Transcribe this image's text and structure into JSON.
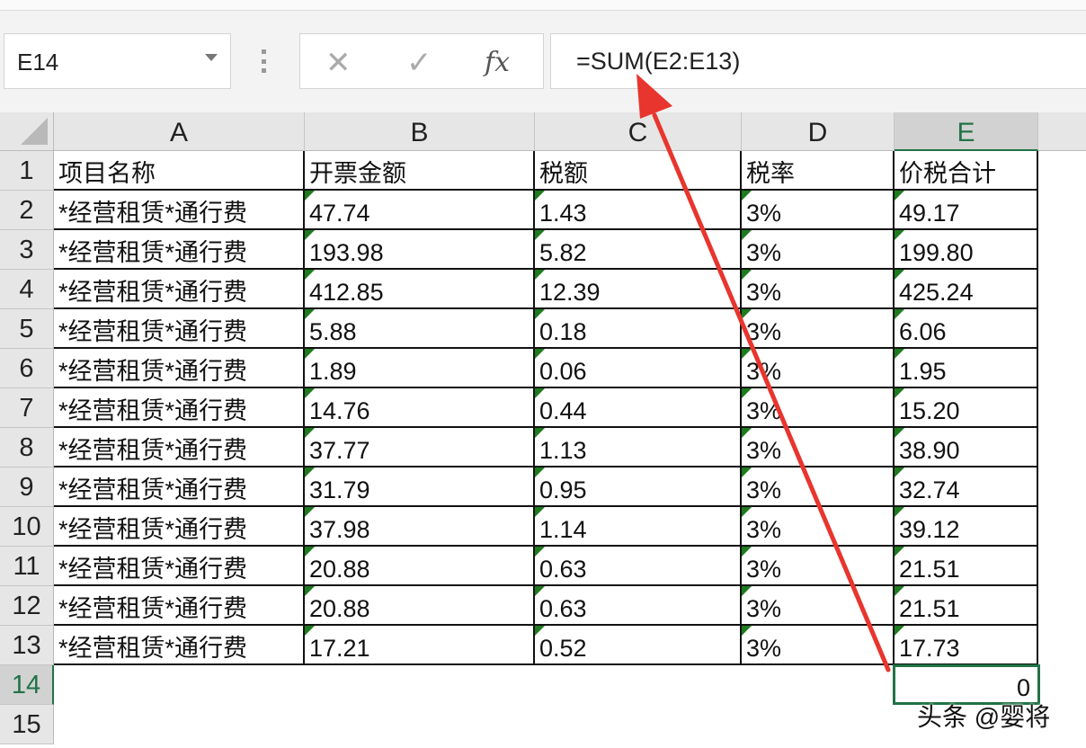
{
  "name_box": {
    "value": "E14"
  },
  "formula_bar": {
    "cancel_icon": "✕",
    "enter_icon": "✓",
    "fx_label": "fx",
    "formula": "=SUM(E2:E13)"
  },
  "columns": [
    "A",
    "B",
    "C",
    "D",
    "E"
  ],
  "selected_column": "E",
  "selected_row": 14,
  "row_numbers": [
    1,
    2,
    3,
    4,
    5,
    6,
    7,
    8,
    9,
    10,
    11,
    12,
    13,
    14,
    15
  ],
  "header_row": [
    "项目名称",
    "开票金额",
    "税额",
    "税率",
    "价税合计"
  ],
  "rows": [
    [
      "*经营租赁*通行费",
      "47.74",
      "1.43",
      "3%",
      "49.17"
    ],
    [
      "*经营租赁*通行费",
      "193.98",
      "5.82",
      "3%",
      "199.80"
    ],
    [
      "*经营租赁*通行费",
      "412.85",
      "12.39",
      "3%",
      "425.24"
    ],
    [
      "*经营租赁*通行费",
      "5.88",
      "0.18",
      "3%",
      "6.06"
    ],
    [
      "*经营租赁*通行费",
      "1.89",
      "0.06",
      "3%",
      "1.95"
    ],
    [
      "*经营租赁*通行费",
      "14.76",
      "0.44",
      "3%",
      "15.20"
    ],
    [
      "*经营租赁*通行费",
      "37.77",
      "1.13",
      "3%",
      "38.90"
    ],
    [
      "*经营租赁*通行费",
      "31.79",
      "0.95",
      "3%",
      "32.74"
    ],
    [
      "*经营租赁*通行费",
      "37.98",
      "1.14",
      "3%",
      "39.12"
    ],
    [
      "*经营租赁*通行费",
      "20.88",
      "0.63",
      "3%",
      "21.51"
    ],
    [
      "*经营租赁*通行费",
      "20.88",
      "0.63",
      "3%",
      "21.51"
    ],
    [
      "*经营租赁*通行费",
      "17.21",
      "0.52",
      "3%",
      "17.73"
    ]
  ],
  "total_cell": {
    "value": "0"
  },
  "watermark": "头条 @婴将",
  "colors": {
    "accent": "#217346",
    "arrow": "#e8352e"
  }
}
